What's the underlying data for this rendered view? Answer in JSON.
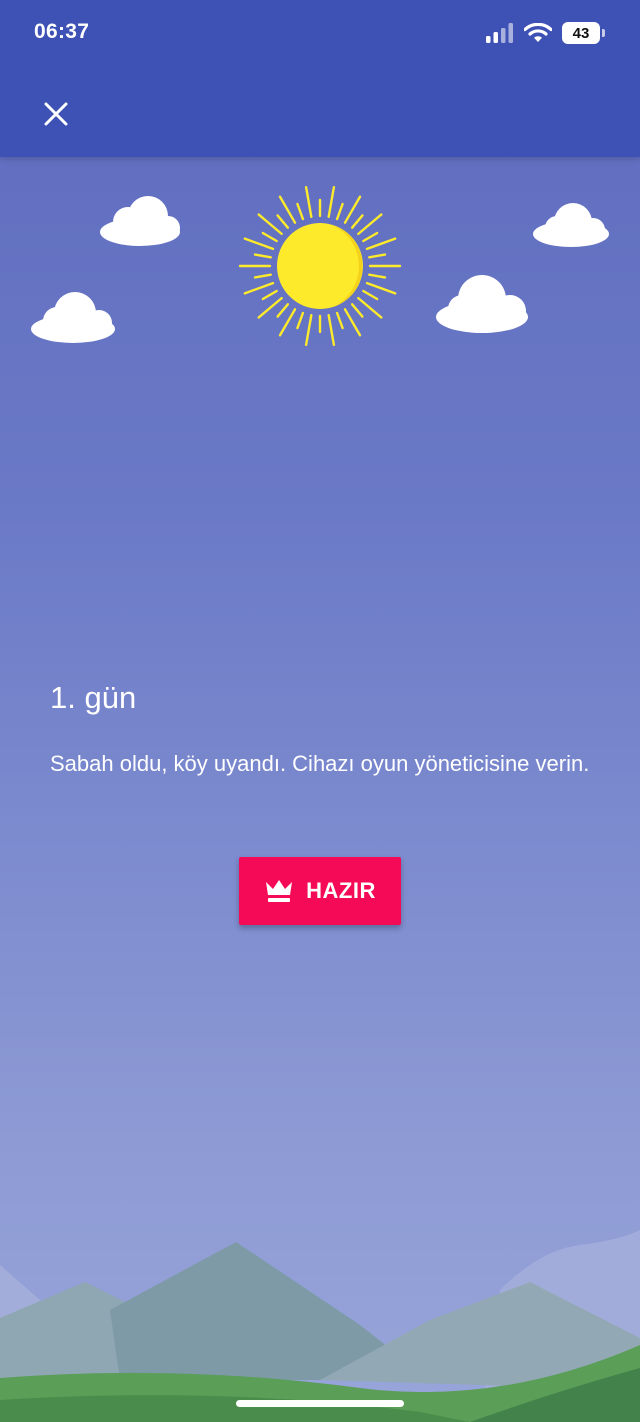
{
  "status_bar": {
    "time": "06:37",
    "battery": "43",
    "icons": [
      "signal-icon",
      "wifi-icon",
      "battery-icon"
    ]
  },
  "toolbar": {
    "close_icon": "close-icon"
  },
  "illustration": {
    "elements": [
      "sun",
      "cloud",
      "cloud",
      "cloud",
      "cloud",
      "mountains",
      "hills"
    ]
  },
  "content": {
    "title": "1. gün",
    "message": "Sabah oldu, köy uyandı. Cihazı oyun yöneticisine verin."
  },
  "ready_button": {
    "label": "HAZIR",
    "icon": "crown-icon"
  },
  "colors": {
    "header": "#3e51b5",
    "accent_button": "#f50a57",
    "sun": "#fdea2a",
    "hills": "#4f9a52"
  }
}
